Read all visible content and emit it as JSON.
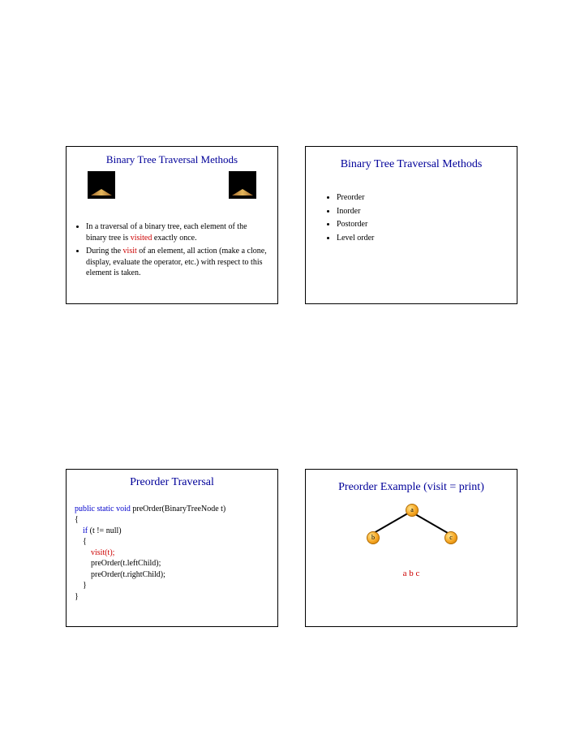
{
  "slide1": {
    "title": "Binary Tree Traversal Methods",
    "bullet1_pre": "In a traversal of a binary tree, each element of the binary tree is ",
    "bullet1_red": "visited",
    "bullet1_post": " exactly once.",
    "bullet2_pre": "During the ",
    "bullet2_red": "visit",
    "bullet2_post": " of an element, all action (make a clone, display, evaluate the operator, etc.) with respect to this element is taken."
  },
  "slide2": {
    "title": "Binary Tree Traversal Methods",
    "items": [
      "Preorder",
      "Inorder",
      "Postorder",
      "Level order"
    ]
  },
  "slide3": {
    "title": "Preorder Traversal",
    "l1a": "public static void ",
    "l1b": "preOrder(BinaryTreeNode t)",
    "l2": "{",
    "l3a": "    if",
    "l3b": " (t != null)",
    "l4": "    {",
    "l5": "        visit(t);",
    "l6": "        preOrder(t.leftChild);",
    "l7": "        preOrder(t.rightChild);",
    "l8": "    }",
    "l9": "}"
  },
  "slide4": {
    "title": "Preorder Example (visit = print)",
    "node_a": "a",
    "node_b": "b",
    "node_c": "c",
    "output": "a b c"
  }
}
